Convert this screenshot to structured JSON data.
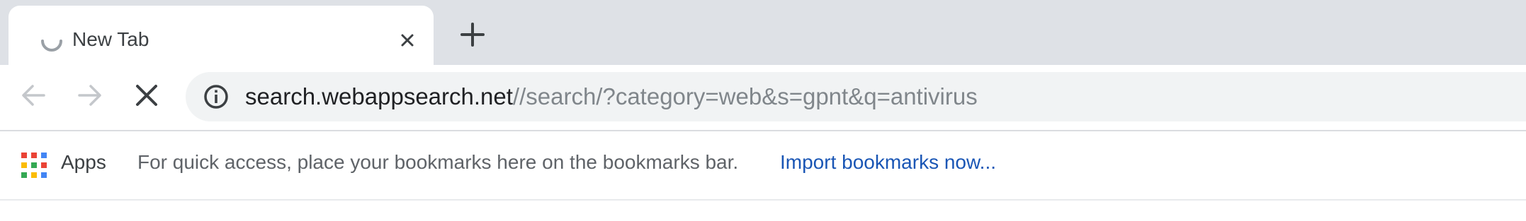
{
  "tabs": [
    {
      "title": "New Tab",
      "loading": true,
      "active": true
    }
  ],
  "toolbar": {
    "back_icon": "arrow-left-icon",
    "forward_icon": "arrow-right-icon",
    "stop_icon": "close-icon"
  },
  "omnibox": {
    "security_icon": "info-icon",
    "url_host": "search.webappsearch.net",
    "url_path": "//search/?category=web&s=gpnt&q=antivirus"
  },
  "bookmarks_bar": {
    "apps_label": "Apps",
    "hint_text": "For quick access, place your bookmarks here on the bookmarks bar.",
    "import_link": "Import bookmarks now..."
  },
  "colors": {
    "tabstrip_bg": "#dee1e6",
    "omnibox_bg": "#f1f3f4",
    "link": "#1a56b5",
    "apps_grid": [
      "#ea4335",
      "#fbbc05",
      "#34a853",
      "#4285f4"
    ]
  }
}
